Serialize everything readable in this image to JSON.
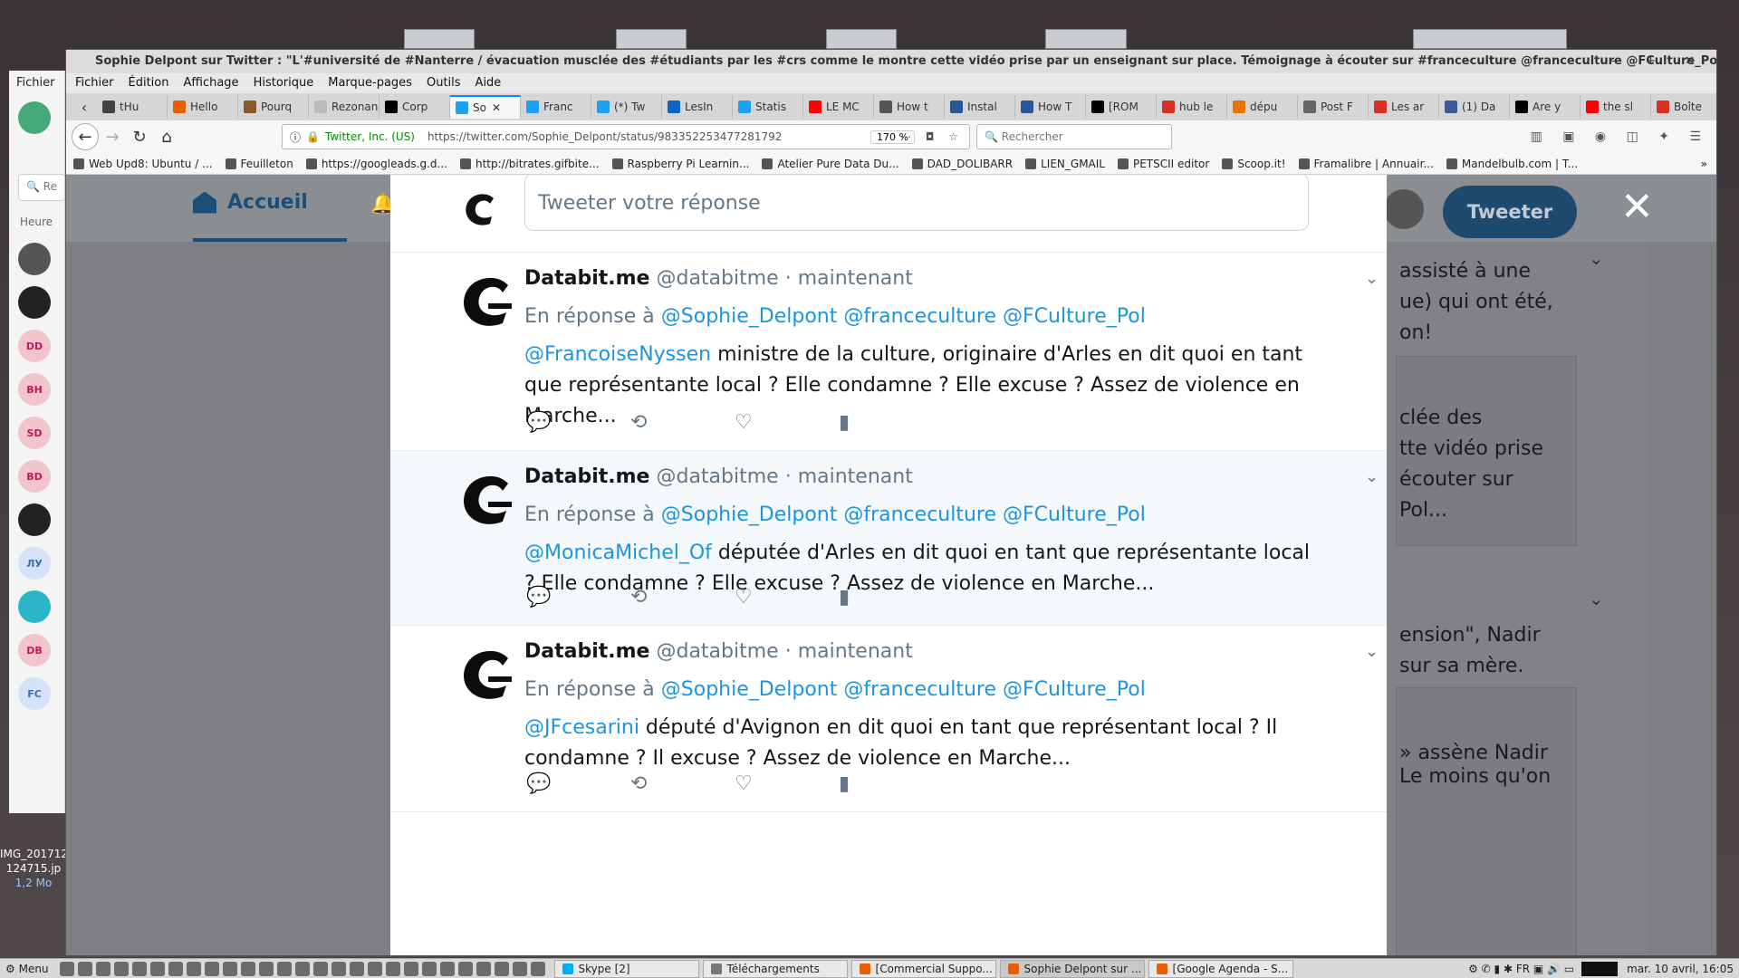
{
  "window": {
    "title": "Sophie Delpont sur Twitter : \"L'#université de #Nanterre / évacuation musclée des #étudiants par les #crs comme le montre cette vidéo prise par un enseignant sur place. Témoignage à écouter sur #franceculture @franceculture @FCulture_Pol dans le journal d",
    "controls": "– + ✕"
  },
  "menubar": [
    "Fichier",
    "Édition",
    "Affichage",
    "Historique",
    "Marque-pages",
    "Outils",
    "Aide"
  ],
  "tabs": [
    {
      "label": "tHu",
      "color": "#444"
    },
    {
      "label": "Hello",
      "color": "#e66000"
    },
    {
      "label": "Pourq",
      "color": "#8b5a2b"
    },
    {
      "label": "Rezonanc",
      "color": "#bbb"
    },
    {
      "label": "Corp",
      "color": "#000"
    },
    {
      "label": "So",
      "color": "#1da1f2",
      "active": true
    },
    {
      "label": "Franc",
      "color": "#1da1f2"
    },
    {
      "label": "(*) Tw",
      "color": "#1da1f2"
    },
    {
      "label": "LesIn",
      "color": "#0a66c2"
    },
    {
      "label": "Statis",
      "color": "#1da1f2"
    },
    {
      "label": "LE MC",
      "color": "#ff0000"
    },
    {
      "label": "How t",
      "color": "#555"
    },
    {
      "label": "Instal",
      "color": "#2b5797"
    },
    {
      "label": "How T",
      "color": "#2b5797"
    },
    {
      "label": "[ROM",
      "color": "#000"
    },
    {
      "label": "hub le",
      "color": "#d93025"
    },
    {
      "label": "dépu",
      "color": "#e37400"
    },
    {
      "label": "Post F",
      "color": "#666"
    },
    {
      "label": "Les ar",
      "color": "#d93025"
    },
    {
      "label": "(1) Da",
      "color": "#3b5998"
    },
    {
      "label": "Are y",
      "color": "#000"
    },
    {
      "label": "the sl",
      "color": "#ff0000"
    },
    {
      "label": "Boîte",
      "color": "#d93025"
    }
  ],
  "nav": {
    "site_identity": "Twitter, Inc. (US)",
    "url": "https://twitter.com/Sophie_Delpont/status/983352253477281792",
    "zoom": "170 %",
    "search_placeholder": "Rechercher"
  },
  "bookmarks": [
    "Web Upd8: Ubuntu / ...",
    "Feuilleton",
    "https://googleads.g.d...",
    "http://bitrates.gifbite...",
    "Raspberry Pi Learnin...",
    "Atelier Pure Data Du...",
    "DAD_DOLIBARR",
    "LIEN_GMAIL",
    "PETSCII editor",
    "Scoop.it!",
    "Framalibre | Annuair...",
    "Mandelbulb.com | T..."
  ],
  "twitter": {
    "nav_home": "Accueil",
    "tweet_button": "Tweeter",
    "reply_placeholder": "Tweeter votre réponse",
    "background_lines": [
      "assisté à une",
      "ue) qui ont été,",
      "on!",
      "clée des",
      "tte vidéo prise",
      "écouter sur",
      "Pol...",
      "ension\", Nadir",
      "sur sa mère.",
      "» assène Nadir",
      "Le moins qu'on"
    ],
    "tweets": [
      {
        "name": "Databit.me",
        "handle": "@databitme",
        "sep": " · ",
        "time": "maintenant",
        "reply_prefix": "En réponse à ",
        "reply_to": [
          "@Sophie_Delpont",
          "@franceculture",
          "@FCulture_Pol"
        ],
        "mention": "@FrancoiseNyssen",
        "text": " ministre de la culture, originaire d'Arles en dit quoi en tant que représentante local ? Elle condamne ? Elle excuse ? Assez de violence en Marche..."
      },
      {
        "name": "Databit.me",
        "handle": "@databitme",
        "sep": " · ",
        "time": "maintenant",
        "reply_prefix": "En réponse à ",
        "reply_to": [
          "@Sophie_Delpont",
          "@franceculture",
          "@FCulture_Pol"
        ],
        "mention": "@MonicaMichel_Of",
        "text": " députée d'Arles en dit quoi en tant que représentante local ? Elle condamne ? Elle excuse ? Assez de violence en Marche..."
      },
      {
        "name": "Databit.me",
        "handle": "@databitme",
        "sep": " · ",
        "time": "maintenant",
        "reply_prefix": "En réponse à ",
        "reply_to": [
          "@Sophie_Delpont",
          "@franceculture",
          "@FCulture_Pol"
        ],
        "mention": "@JFcesarini",
        "text": " député d'Avignon en dit quoi en tant que représentant local ? Il condamne ? Il excuse ? Assez de violence en Marche..."
      }
    ]
  },
  "skype": {
    "menu": "Fichier",
    "search": "Re",
    "heure": "Heure",
    "contacts": [
      {
        "initials": "",
        "color": "#555"
      },
      {
        "initials": "",
        "color": "#222"
      },
      {
        "initials": "DD",
        "color": "#f2c4cc"
      },
      {
        "initials": "BH",
        "color": "#f2c4cc"
      },
      {
        "initials": "SD",
        "color": "#f2c4cc"
      },
      {
        "initials": "BD",
        "color": "#f2c4cc"
      },
      {
        "initials": "",
        "color": "#222"
      },
      {
        "initials": "ЛУ",
        "color": "#d4e3f7"
      },
      {
        "initials": "",
        "color": "#2bb5c9"
      },
      {
        "initials": "DB",
        "color": "#f2c4cc"
      },
      {
        "initials": "FC",
        "color": "#d4e3f7"
      }
    ]
  },
  "desktop_file": {
    "name": "IMG_201712 124715.jp",
    "size": "1,2 Mo"
  },
  "taskbar": {
    "menu": "Menu",
    "tasks": [
      {
        "label": "Skype [2]",
        "color": "#00aff0"
      },
      {
        "label": "Téléchargements",
        "color": "#777"
      },
      {
        "label": "[Commercial Suppo...",
        "color": "#e66000"
      },
      {
        "label": "Sophie Delpont sur ...",
        "color": "#e66000",
        "active": true
      },
      {
        "label": "[Google Agenda - S...",
        "color": "#e66000"
      }
    ],
    "lang": "FR",
    "clock": "mar. 10 avril, 16:05"
  }
}
